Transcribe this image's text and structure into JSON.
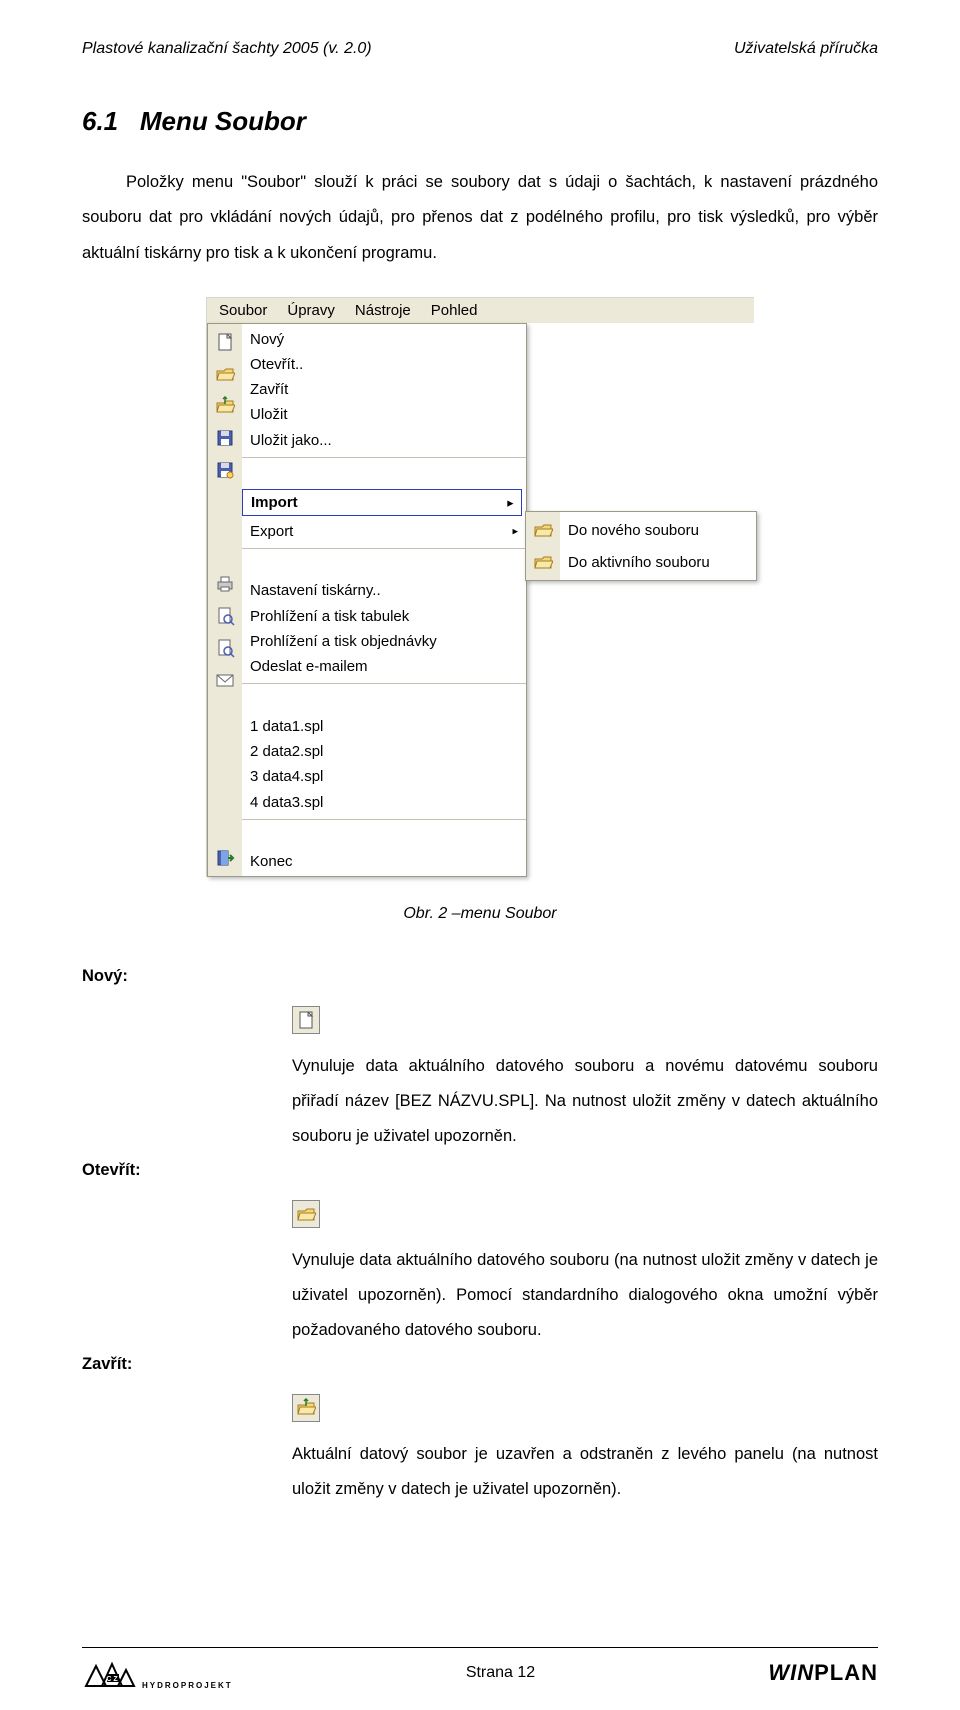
{
  "header": {
    "left": "Plastové kanalizační šachty 2005 (v. 2.0)",
    "right": "Uživatelská příručka"
  },
  "section": {
    "number": "6.1",
    "title": "Menu Soubor",
    "paragraph": "Položky menu \"Soubor\" slouží k práci se soubory dat s údaji o šachtách, k nastavení prázdného souboru dat pro vkládání nových údajů, pro přenos dat z podélného profilu, pro tisk výsledků, pro výběr aktuální tiskárny pro tisk a k ukončení programu."
  },
  "menu": {
    "menubar": [
      "Soubor",
      "Úpravy",
      "Nástroje",
      "Pohled"
    ],
    "items": [
      {
        "icon": "new",
        "label": "Nový"
      },
      {
        "icon": "open",
        "label": "Otevřít.."
      },
      {
        "icon": "close",
        "label": "Zavřít"
      },
      {
        "icon": "save",
        "label": "Uložit"
      },
      {
        "icon": "saveas",
        "label": "Uložit jako..."
      },
      {
        "sep": true
      },
      {
        "icon": "",
        "label": "Import",
        "sub": true,
        "hl": true
      },
      {
        "icon": "",
        "label": "Export",
        "sub": true
      },
      {
        "sep": true
      },
      {
        "icon": "printer",
        "label": "Nastavení tiskárny.."
      },
      {
        "icon": "preview",
        "label": "Prohlížení a tisk tabulek"
      },
      {
        "icon": "preview",
        "label": "Prohlížení a tisk objednávky"
      },
      {
        "icon": "mail",
        "label": "Odeslat e-mailem"
      },
      {
        "sep": true
      },
      {
        "icon": "",
        "label": "1 data1.spl"
      },
      {
        "icon": "",
        "label": "2 data2.spl"
      },
      {
        "icon": "",
        "label": "3 data4.spl"
      },
      {
        "icon": "",
        "label": "4 data3.spl"
      },
      {
        "sep": true
      },
      {
        "icon": "exit",
        "label": "Konec"
      }
    ],
    "submenu": [
      {
        "icon": "open",
        "label": "Do nového souboru"
      },
      {
        "icon": "open",
        "label": "Do aktivního souboru"
      }
    ]
  },
  "figure_caption": "Obr. 2 –menu Soubor",
  "defs": {
    "novy": {
      "label": "Nový:",
      "icon": "new",
      "text": "Vynuluje data aktuálního datového souboru a novému datovému souboru přiřadí název [BEZ NÁZVU.SPL]. Na nutnost uložit změny v datech aktuálního souboru je uživatel upozorněn."
    },
    "otevrit": {
      "label": "Otevřít:",
      "icon": "open",
      "text": "Vynuluje data aktuálního datového souboru (na nutnost uložit změny v datech je uživatel upozorněn). Pomocí standardního dialogového okna umožní výběr požadovaného datového souboru."
    },
    "zavrit": {
      "label": "Zavřít:",
      "icon": "close",
      "text": "Aktuální datový soubor je uzavřen a odstraněn z levého panelu (na nutnost uložit změny v datech je uživatel upozorněn)."
    }
  },
  "footer": {
    "hp_label": "HYDROPROJEKT",
    "center": "Strana 12",
    "right_a": "WIN",
    "right_b": "PLAN"
  }
}
